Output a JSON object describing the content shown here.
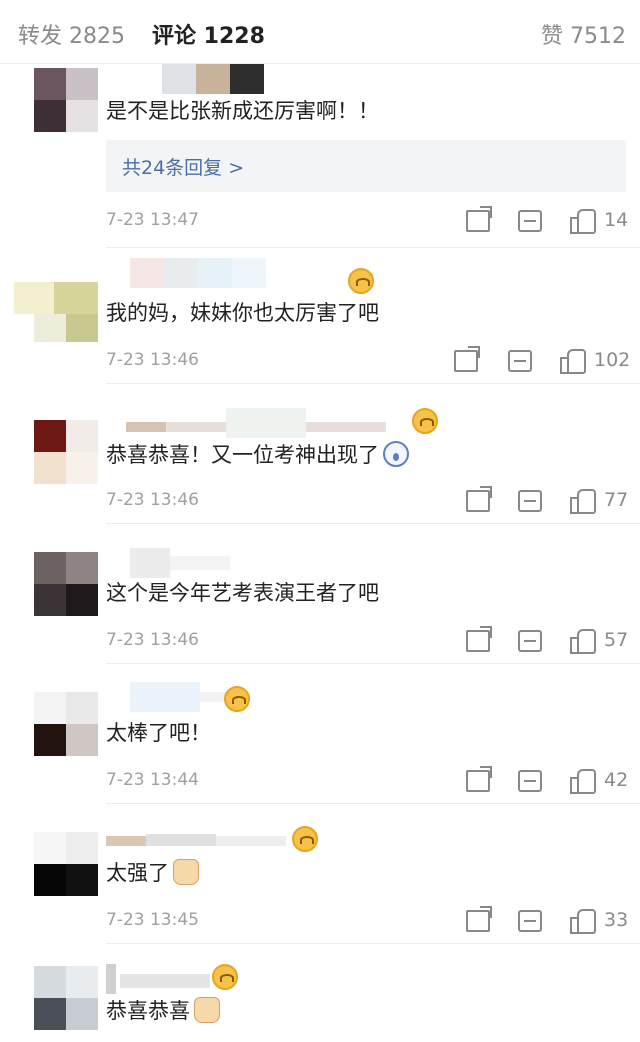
{
  "tabs": {
    "repost": "转发 2825",
    "comment": "评论 1228",
    "like": "赞 7512"
  },
  "reply_summary": "共24条回复 >",
  "comments": [
    {
      "text": "是不是比张新成还厉害啊！！",
      "time": "7-23 13:47",
      "likes": "14"
    },
    {
      "text": "我的妈，妹妹你也太厉害了吧",
      "time": "7-23 13:46",
      "likes": "102"
    },
    {
      "text": "恭喜恭喜！又一位考神出现了",
      "time": "7-23 13:46",
      "likes": "77"
    },
    {
      "text": "这个是今年艺考表演王者了吧",
      "time": "7-23 13:46",
      "likes": "57"
    },
    {
      "text": "太棒了吧！",
      "time": "7-23 13:44",
      "likes": "42"
    },
    {
      "text": "太强了",
      "time": "7-23 13:45",
      "likes": "33"
    },
    {
      "text": "恭喜恭喜",
      "time": "",
      "likes": ""
    }
  ],
  "icons": {
    "share": "share-icon",
    "comment": "comment-icon",
    "like": "thumbs-up-icon",
    "vip": "vip-badge-icon",
    "emoji_surprised": "surprised-emoji-icon",
    "emoji_thumb": "thumbs-up-emoji-icon"
  },
  "colors": {
    "link": "#4a6fa5",
    "muted": "#a0a0a0",
    "text": "#222222"
  }
}
